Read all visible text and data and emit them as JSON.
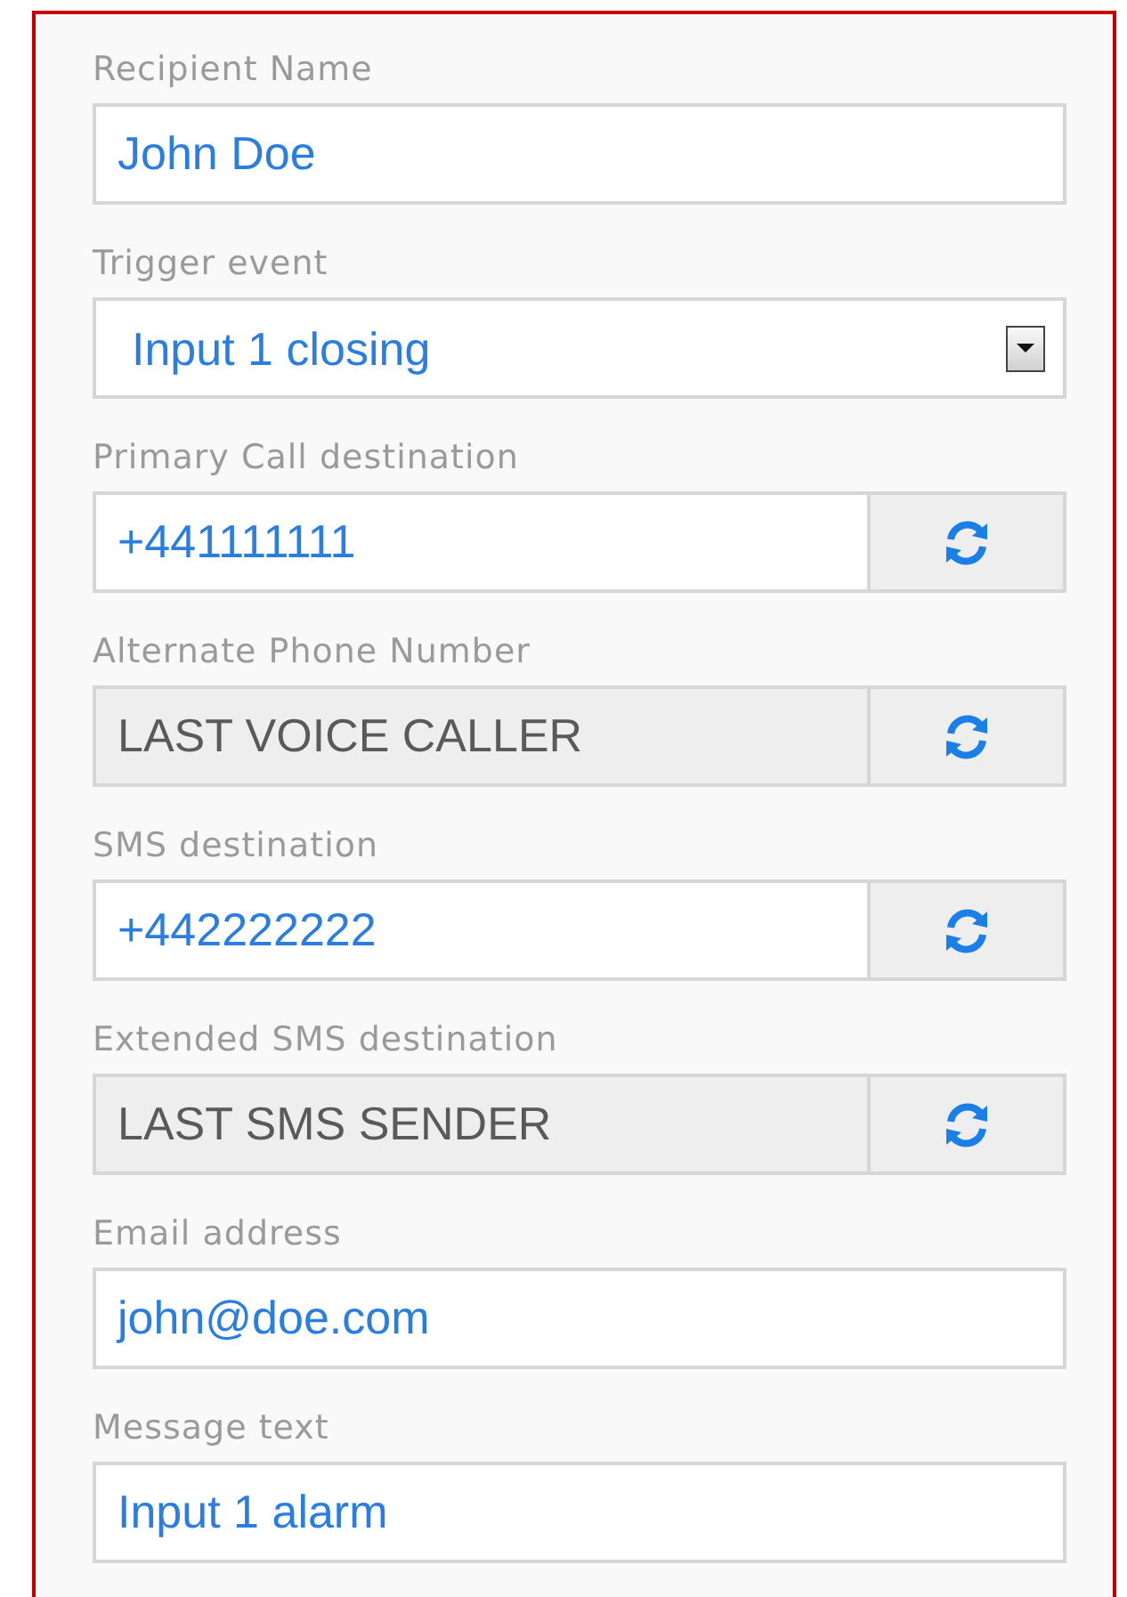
{
  "fields": [
    {
      "kind": "text",
      "label": "Recipient Name",
      "value": "John Doe",
      "disabled": false
    },
    {
      "kind": "select",
      "label": "Trigger event",
      "value": "Input 1 closing",
      "disabled": false
    },
    {
      "kind": "phone",
      "label": "Primary Call destination",
      "value": "+441111111",
      "disabled": false
    },
    {
      "kind": "phone",
      "label": "Alternate Phone Number",
      "value": "LAST VOICE CALLER",
      "disabled": true
    },
    {
      "kind": "phone",
      "label": "SMS destination",
      "value": "+442222222",
      "disabled": false
    },
    {
      "kind": "phone",
      "label": "Extended SMS destination",
      "value": "LAST SMS SENDER",
      "disabled": true
    },
    {
      "kind": "text",
      "label": "Email address",
      "value": "john@doe.com",
      "disabled": false
    },
    {
      "kind": "text",
      "label": "Message text",
      "value": "Input 1 alarm",
      "disabled": false
    }
  ]
}
